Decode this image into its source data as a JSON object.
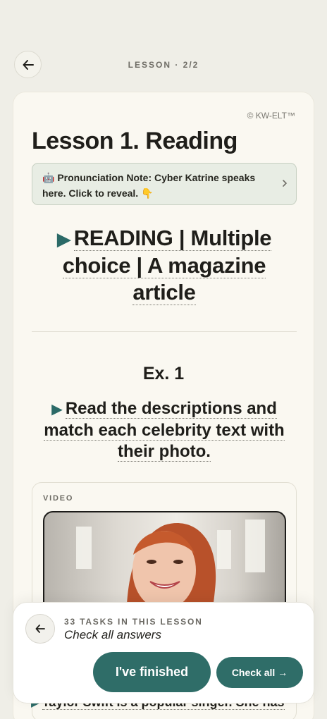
{
  "header": {
    "progress": "LESSON · 2/2",
    "back_icon": "arrow-left-icon"
  },
  "card": {
    "copyright": "© KW-ELT™",
    "title": "Lesson 1. Reading",
    "note": {
      "emoji": "🤖",
      "text": "Pronunciation Note: Cyber Katrine speaks here. Click to reveal.",
      "hand": "👇",
      "chevron_icon": "chevron-right-icon"
    },
    "section_heading_lines": [
      "READING | Multiple",
      "choice | A magazine",
      "article"
    ],
    "exercise_title": "Ex. 1",
    "instruction_lines": [
      "Read the descriptions and",
      "match each celebrity text with",
      "their photo."
    ],
    "video": {
      "label": "VIDEO"
    },
    "next_text": "Taylor Swift is a popular singer. She has"
  },
  "bottom_sheet": {
    "tasks_count": "33 TASKS IN THIS LESSON",
    "subtitle": "Check all answers",
    "finish_label": "I've finished",
    "check_all_label": "Check all →"
  },
  "colors": {
    "accent": "#2f6d68",
    "background": "#efeee7",
    "card": "#faf8f1"
  }
}
